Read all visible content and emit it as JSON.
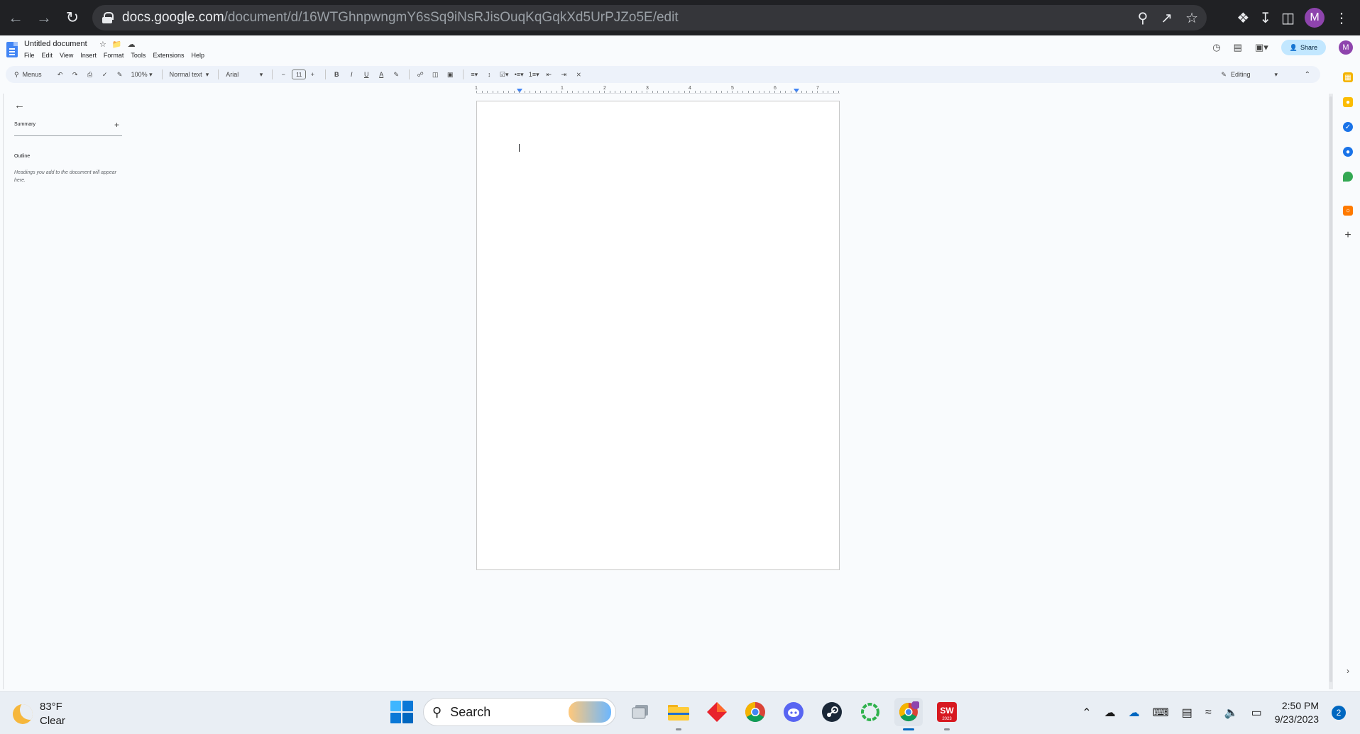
{
  "browser": {
    "url_domain": "docs.google.com",
    "url_path": "/document/d/16WTGhnpwngmY6sSq9iNsRJisOuqKqGqkXd5UrPJZo5E/edit",
    "profile_initial": "M"
  },
  "doc": {
    "title": "Untitled document",
    "menus": [
      "File",
      "Edit",
      "View",
      "Insert",
      "Format",
      "Tools",
      "Extensions",
      "Help"
    ],
    "share_label": "Share",
    "profile_initial": "M"
  },
  "toolbar": {
    "search_menus": "Menus",
    "zoom": "100%",
    "style": "Normal text",
    "font": "Arial",
    "font_size": "11",
    "mode": "Editing"
  },
  "ruler": {
    "numbers": [
      "1",
      "1",
      "2",
      "3",
      "4",
      "5",
      "6",
      "7"
    ]
  },
  "outline_panel": {
    "summary_label": "Summary",
    "outline_label": "Outline",
    "hint": "Headings you add to the document will appear here."
  },
  "taskbar": {
    "temperature": "83°F",
    "condition": "Clear",
    "search_label": "Search",
    "time": "2:50 PM",
    "date": "9/23/2023",
    "notification_count": "2"
  },
  "colors": {
    "chrome_bg": "#202124",
    "docs_blue": "#4285f4",
    "share_bg": "#c2e7ff",
    "toolbar_bg": "#edf2fa"
  }
}
